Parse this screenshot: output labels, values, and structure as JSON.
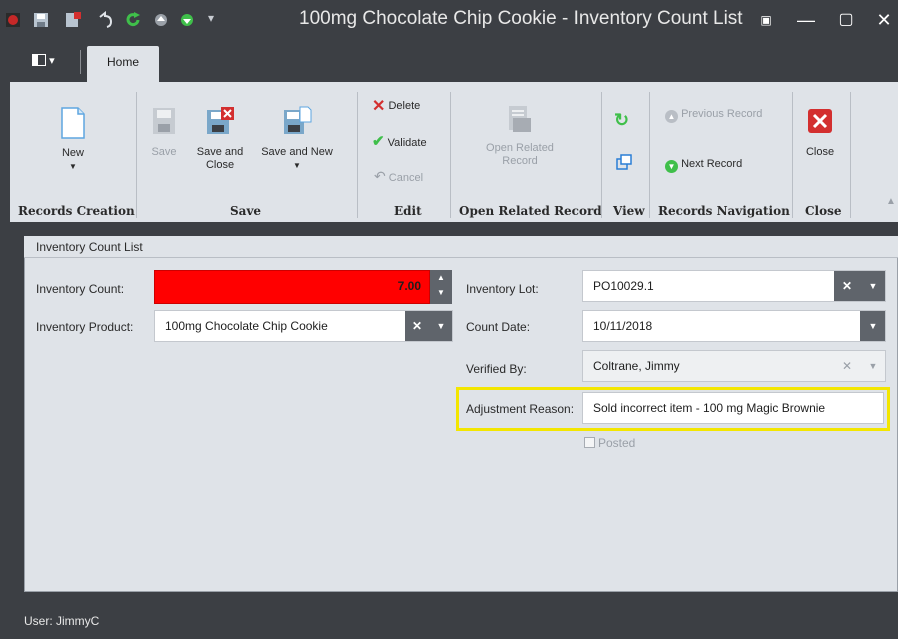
{
  "window": {
    "title": "100mg Chocolate Chip Cookie - Inventory Count List"
  },
  "tabs": {
    "view_menu_icon": "panel-layout-icon",
    "home": "Home"
  },
  "ribbon": {
    "records_creation": {
      "label": "Records Creation",
      "new": "New"
    },
    "save": {
      "label": "Save",
      "save": "Save",
      "save_and_close": "Save and Close",
      "save_and_new": "Save and New"
    },
    "edit": {
      "label": "Edit",
      "delete": "Delete",
      "validate": "Validate",
      "cancel": "Cancel"
    },
    "open_related": {
      "label": "Open Related Record",
      "button": "Open Related Record"
    },
    "view": {
      "label": "View"
    },
    "navigation": {
      "label": "Records Navigation",
      "previous": "Previous Record",
      "next": "Next Record"
    },
    "close": {
      "label": "Close",
      "button": "Close"
    }
  },
  "form": {
    "panel_title": "Inventory Count List",
    "inventory_count": {
      "label": "Inventory Count:",
      "value": "7.00"
    },
    "inventory_product": {
      "label": "Inventory Product:",
      "value": "100mg Chocolate Chip Cookie"
    },
    "inventory_lot": {
      "label": "Inventory Lot:",
      "value": "PO10029.1"
    },
    "count_date": {
      "label": "Count Date:",
      "value": "10/11/2018"
    },
    "verified_by": {
      "label": "Verified By:",
      "value": "Coltrane, Jimmy"
    },
    "adjustment_reason": {
      "label": "Adjustment Reason:",
      "value": "Sold incorrect item - 100 mg Magic Brownie"
    },
    "posted": {
      "label": "Posted",
      "checked": false
    }
  },
  "status": {
    "user": "User: JimmyC"
  },
  "colors": {
    "error_field": "#ff0000",
    "highlight": "#f3e600",
    "chrome": "#3c3f44",
    "ribbon": "#dfe3e8"
  }
}
